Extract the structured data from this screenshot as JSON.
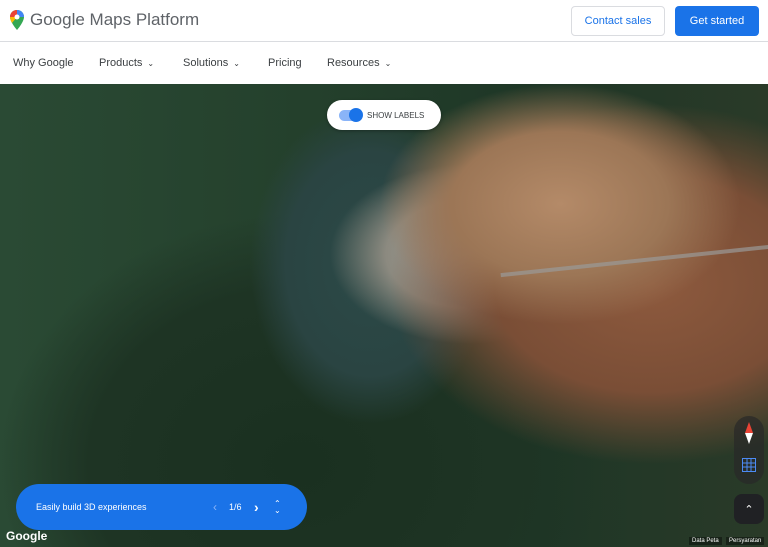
{
  "header": {
    "brand": "Google Maps Platform",
    "contact_label": "Contact sales",
    "start_label": "Get started"
  },
  "nav": {
    "items": [
      {
        "label": "Why Google"
      },
      {
        "label": "Products"
      },
      {
        "label": "Solutions"
      },
      {
        "label": "Pricing"
      },
      {
        "label": "Resources"
      }
    ]
  },
  "map": {
    "toggle_label": "SHOW LABELS",
    "toggle_on": true,
    "carousel_text": "Easily build 3D experiences",
    "page": "1/6",
    "google_label": "Google",
    "map_data": "Data Peta",
    "terms": "Persyaratan"
  }
}
